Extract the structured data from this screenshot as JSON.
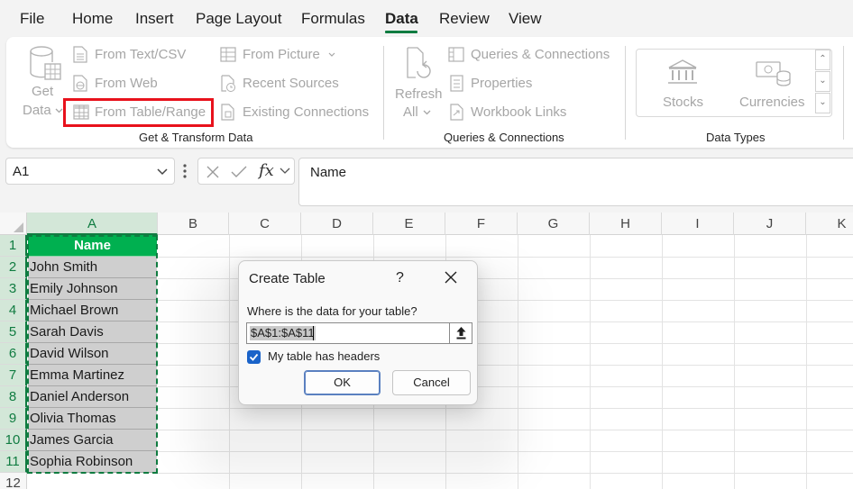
{
  "menu": {
    "tabs": [
      "File",
      "Home",
      "Insert",
      "Page Layout",
      "Formulas",
      "Data",
      "Review",
      "View"
    ],
    "active": "Data"
  },
  "ribbon": {
    "get_data_line1": "Get",
    "get_data_line2": "Data",
    "from_text_csv": "From Text/CSV",
    "from_web": "From Web",
    "from_table_range": "From Table/Range",
    "from_picture": "From Picture",
    "recent_sources": "Recent Sources",
    "existing_connections": "Existing Connections",
    "group_get_transform": "Get & Transform Data",
    "refresh_line1": "Refresh",
    "refresh_line2": "All",
    "queries_connections": "Queries & Connections",
    "properties": "Properties",
    "workbook_links": "Workbook Links",
    "group_queries": "Queries & Connections",
    "stocks": "Stocks",
    "currencies": "Currencies",
    "group_data_types": "Data Types"
  },
  "formula_bar": {
    "name_box": "A1",
    "formula_value": "Name",
    "fx_label": "fx"
  },
  "sheet": {
    "columns": [
      "A",
      "B",
      "C",
      "D",
      "E",
      "F",
      "G",
      "H",
      "I",
      "J",
      "K"
    ],
    "rows": [
      "1",
      "2",
      "3",
      "4",
      "5",
      "6",
      "7",
      "8",
      "9",
      "10",
      "11",
      "12"
    ],
    "column_a": [
      "Name",
      "John Smith",
      "Emily Johnson",
      "Michael Brown",
      "Sarah Davis",
      "David Wilson",
      "Emma Martinez",
      "Daniel Anderson",
      "Olivia Thomas",
      "James Garcia",
      "Sophia Robinson"
    ]
  },
  "dialog": {
    "title": "Create Table",
    "help": "?",
    "question": "Where is the data for your table?",
    "range_value": "$A$1:$A$11",
    "checkbox_label": "My table has headers",
    "checkbox_checked": true,
    "ok_label": "OK",
    "cancel_label": "Cancel"
  },
  "colors": {
    "accent_green": "#107c41",
    "header_cell_green": "#00b050",
    "highlight_red": "#e8121c",
    "checkbox_blue": "#1a63c9"
  }
}
